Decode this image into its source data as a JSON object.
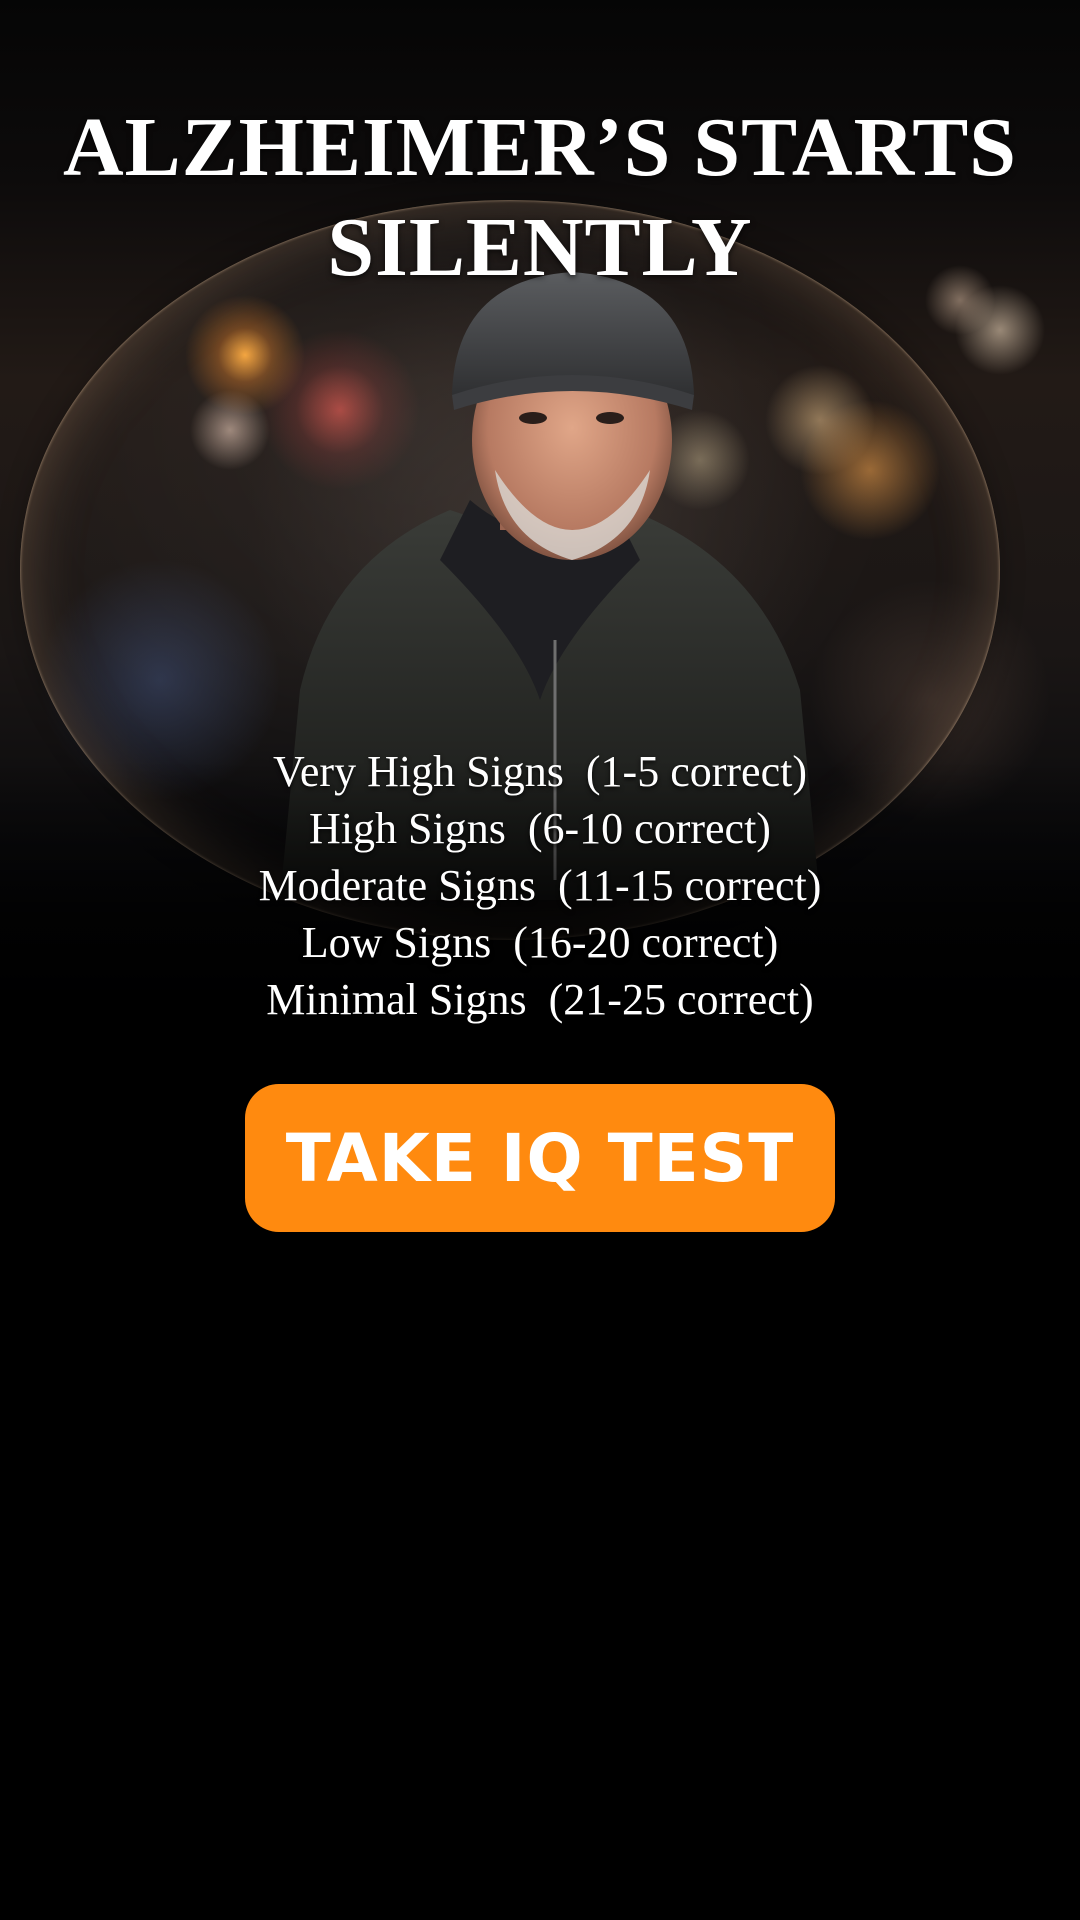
{
  "headline": {
    "line1": "ALZHEIMER’S STARTS",
    "line2": "SILENTLY"
  },
  "signs": [
    "Very High Signs  (1-5 correct)",
    "High Signs  (6-10 correct)",
    "Moderate Signs  (11-15 correct)",
    "Low Signs  (16-20 correct)",
    "Minimal Signs  (21-25 correct)"
  ],
  "cta": {
    "label": "TAKE IQ TEST"
  },
  "colors": {
    "background": "#000000",
    "cta_background": "#ff8a0f",
    "text": "#ffffff"
  },
  "image": {
    "subject": "elderly-man-in-bubble-photo"
  }
}
